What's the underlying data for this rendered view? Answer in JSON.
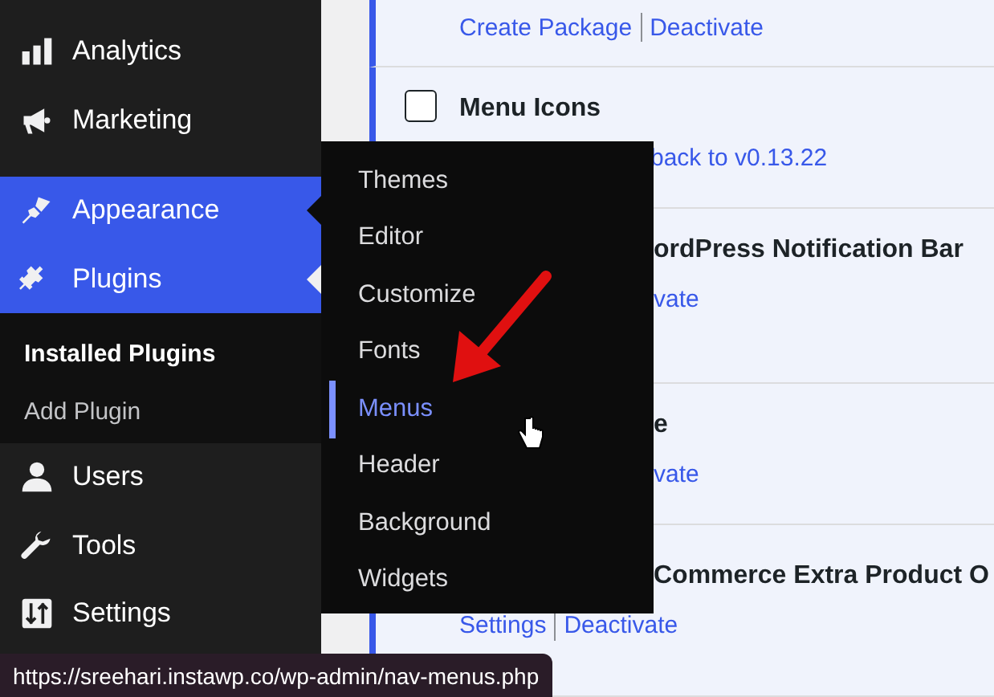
{
  "sidebar": {
    "items": [
      {
        "label": "Analytics",
        "selected": false,
        "open": false
      },
      {
        "label": "Marketing",
        "selected": false,
        "open": false
      },
      {
        "label": "Appearance",
        "selected": false,
        "open": true
      },
      {
        "label": "Plugins",
        "selected": true,
        "open": false,
        "submenu": [
          {
            "label": "Installed Plugins",
            "selected": true
          },
          {
            "label": "Add Plugin",
            "selected": false
          }
        ]
      },
      {
        "label": "Users",
        "selected": false,
        "open": false
      },
      {
        "label": "Tools",
        "selected": false,
        "open": false
      },
      {
        "label": "Settings",
        "selected": false,
        "open": false
      }
    ]
  },
  "flyout": {
    "items": [
      {
        "label": "Themes",
        "selected": false
      },
      {
        "label": "Editor",
        "selected": false
      },
      {
        "label": "Customize",
        "selected": false
      },
      {
        "label": "Fonts",
        "selected": false
      },
      {
        "label": "Menus",
        "selected": true
      },
      {
        "label": "Header",
        "selected": false
      },
      {
        "label": "Background",
        "selected": false
      },
      {
        "label": "Widgets",
        "selected": false
      }
    ]
  },
  "plugins": {
    "rows": [
      {
        "links": [
          "Create Package",
          "Deactivate"
        ]
      },
      {
        "checked": false,
        "title": "Menu Icons",
        "links": [
          "back to v0.13.22"
        ]
      },
      {
        "title": "ordPress Notification Bar",
        "links": [
          "vate"
        ]
      },
      {
        "title": "e",
        "links": [
          "vate"
        ]
      },
      {
        "title": "Commerce Extra Product O",
        "links": [
          "Settings",
          "Deactivate"
        ]
      }
    ]
  },
  "status_bar": {
    "url": "https://sreehari.instawp.co/wp-admin/nav-menus.php"
  }
}
